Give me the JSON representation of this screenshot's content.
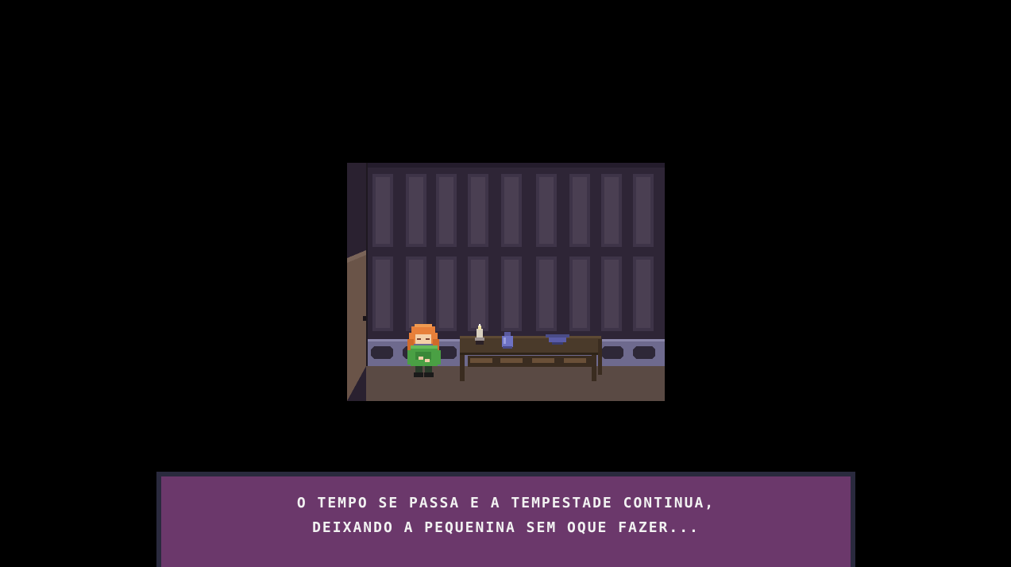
{
  "scene": {
    "location": "",
    "characters": [
      "red-haired girl in green sweater"
    ],
    "objects": [
      "wall panels",
      "wooden side table",
      "candle",
      "blue vase",
      "blue bowl",
      "door"
    ]
  },
  "dialogue": {
    "line1": "O tempo se passa e a tempestade continua,",
    "line2": "deixando a pequenina sem oque fazer..."
  },
  "colors": {
    "background": "#000000",
    "wall": "#2e2536",
    "panel": "#4a3f52",
    "baseboard": "#6e6a8e",
    "floor": "#5a4a44",
    "table": "#4a3a2a",
    "dialogue_border": "#2a2a3e",
    "dialogue_fill": "#6b386b",
    "dialogue_text": "#f2f2f2"
  }
}
